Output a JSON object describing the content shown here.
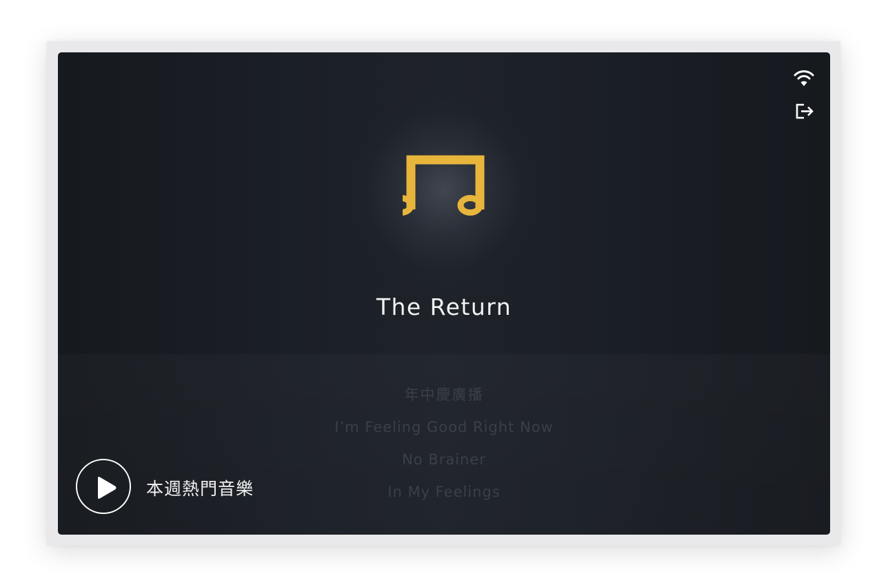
{
  "now_playing": {
    "title": "The Return",
    "icon": "music-note-icon",
    "icon_color": "#e8b53c"
  },
  "playlist": {
    "items": [
      "年中慶廣播",
      "I’m Feeling Good Right Now",
      "No Brainer",
      "In My Feelings"
    ]
  },
  "status_icons": {
    "wifi": "wifi-icon",
    "logout": "logout-icon"
  },
  "player": {
    "play_icon": "play-icon",
    "playlist_label": "本週熱門音樂"
  },
  "colors": {
    "background": "#1c2027",
    "accent": "#e8b53c",
    "text": "#f2f2f2",
    "muted_text": "#3a4049"
  }
}
